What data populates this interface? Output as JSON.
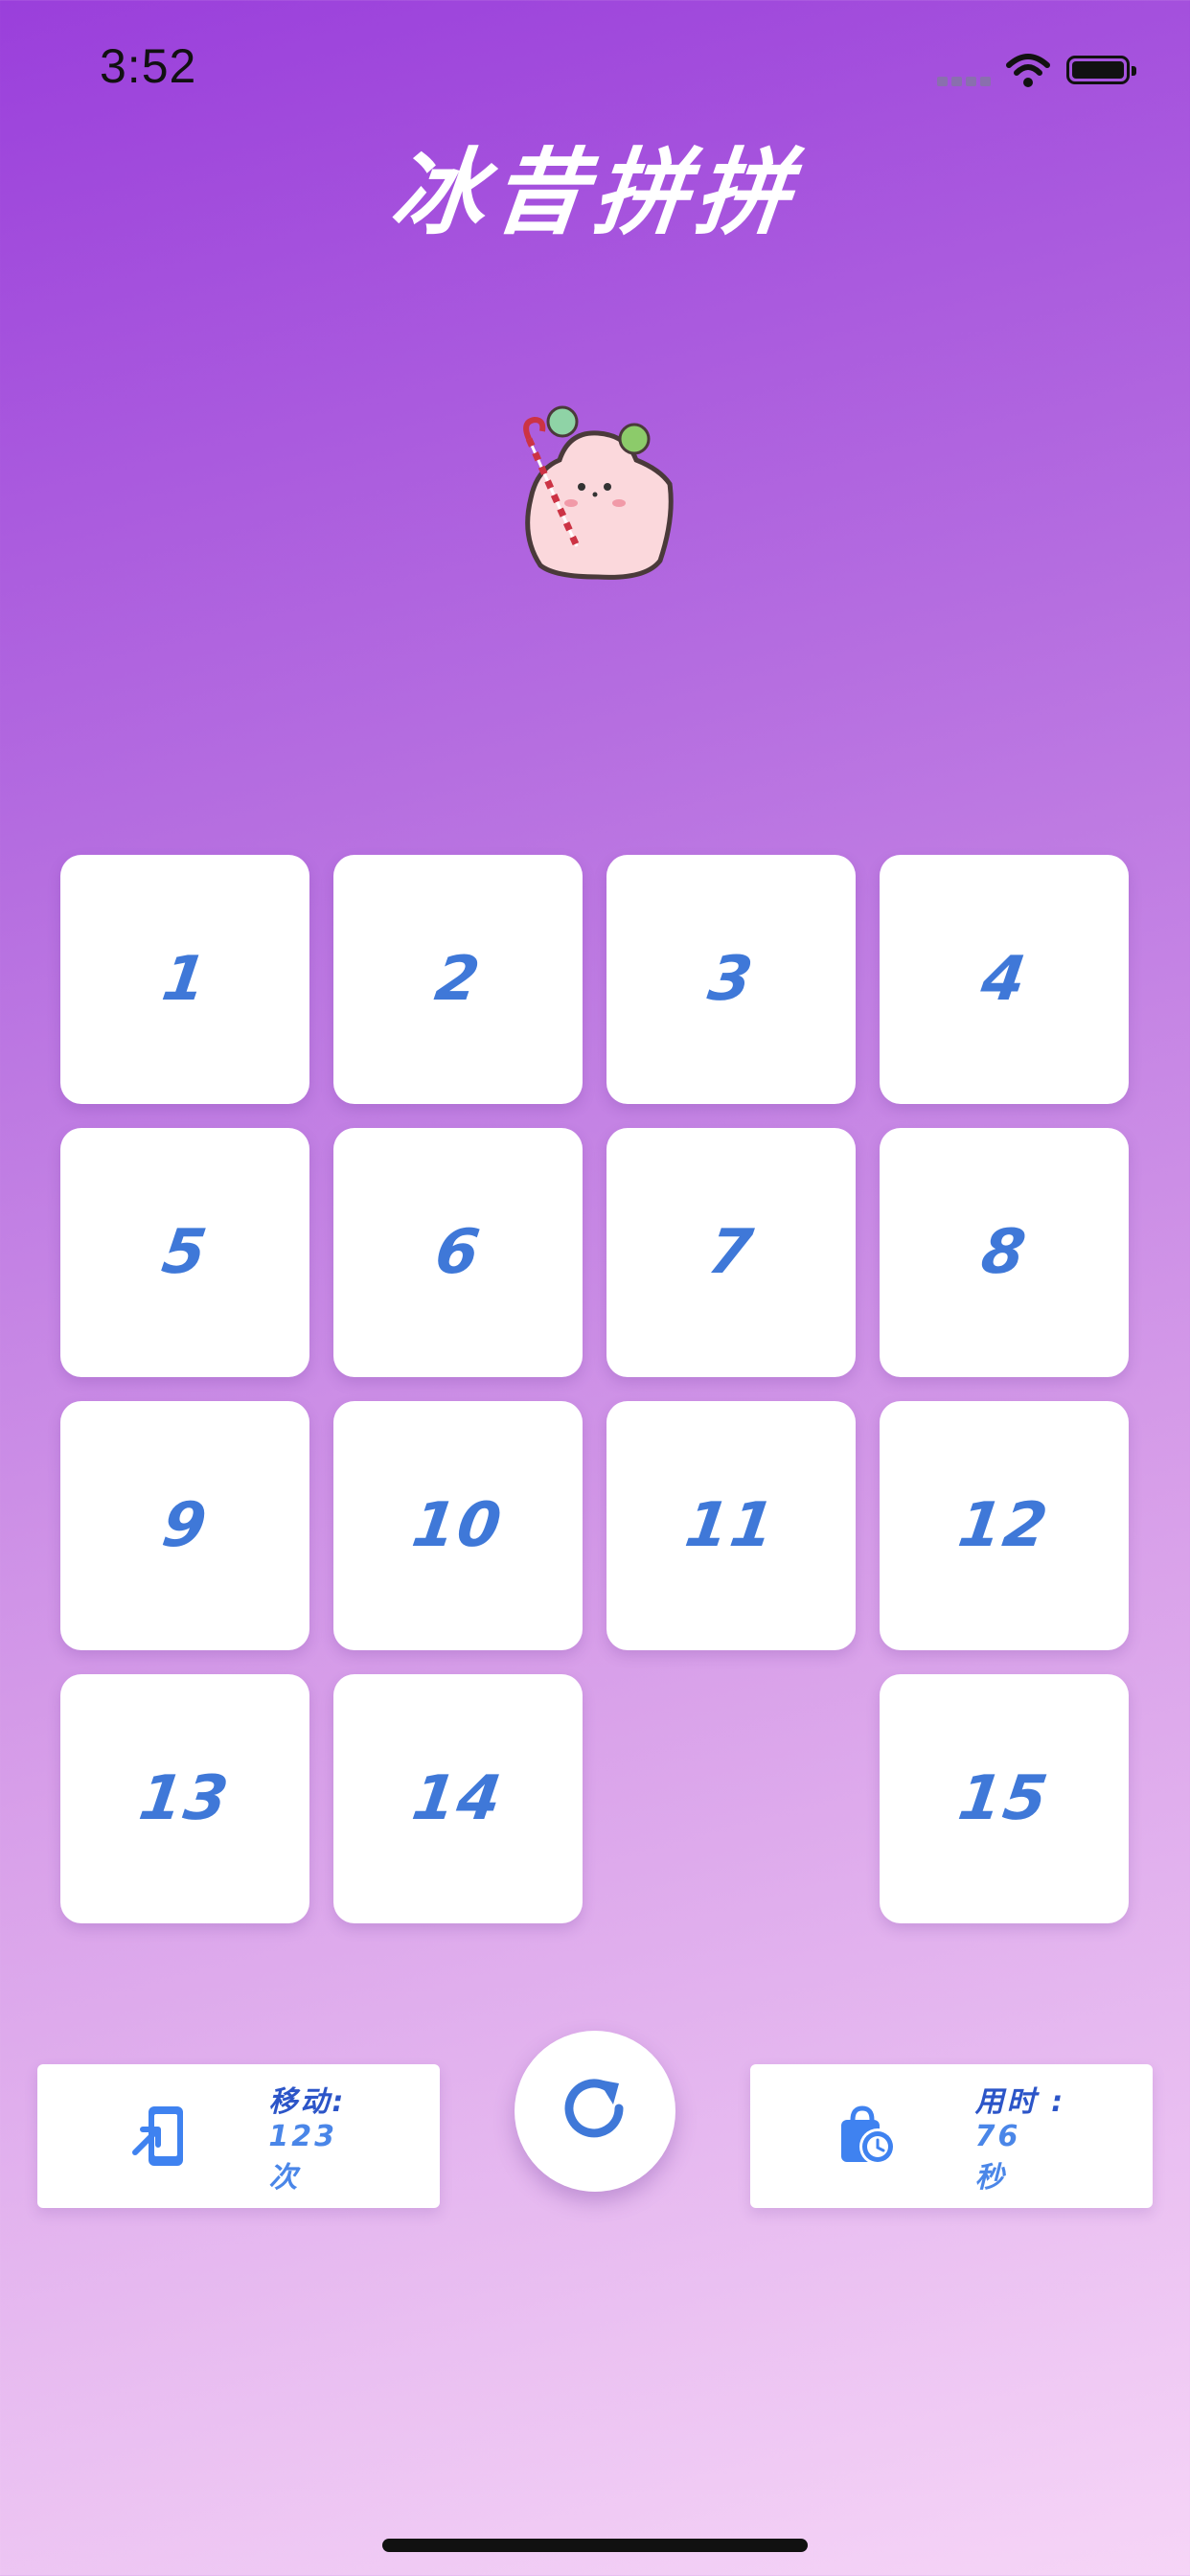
{
  "status_bar": {
    "time": "3:52"
  },
  "app": {
    "title": "冰昔拼拼"
  },
  "board": {
    "tiles": [
      {
        "label": "1"
      },
      {
        "label": "2"
      },
      {
        "label": "3"
      },
      {
        "label": "4"
      },
      {
        "label": "5"
      },
      {
        "label": "6"
      },
      {
        "label": "7"
      },
      {
        "label": "8"
      },
      {
        "label": "9"
      },
      {
        "label": "10"
      },
      {
        "label": "11"
      },
      {
        "label": "12"
      },
      {
        "label": "13"
      },
      {
        "label": "14"
      },
      {
        "label": ""
      },
      {
        "label": "15"
      }
    ]
  },
  "stats": {
    "moves_label": "移动:",
    "moves_value": "123",
    "moves_unit": "次",
    "time_label": "用时 :",
    "time_value": "76",
    "time_unit": "秒"
  },
  "icons": {
    "moves": "phone-move-icon",
    "time": "bag-clock-icon",
    "reset": "refresh-icon"
  },
  "colors": {
    "tile_number": "#3f78d8",
    "accent_blue": "#4a86e8",
    "gradient_top": "#9a3fdb",
    "gradient_bottom": "#f6d5f7"
  }
}
